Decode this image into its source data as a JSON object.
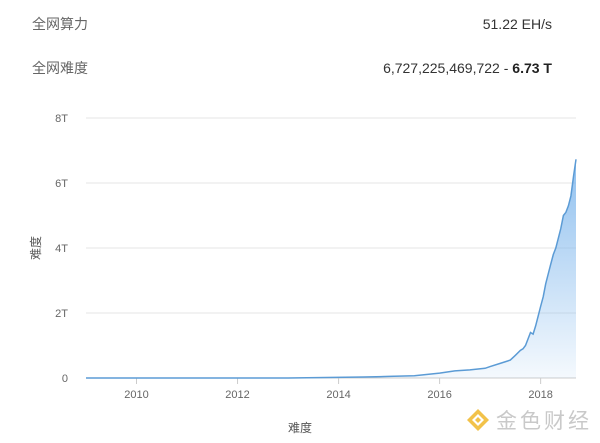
{
  "stats": {
    "hashrate": {
      "label": "全网算力",
      "value": "51.22 EH/s"
    },
    "difficulty": {
      "label": "全网难度",
      "value": "6,727,225,469,722",
      "separator": " - ",
      "short": "6.73 T"
    }
  },
  "watermark": {
    "text": "金色财经",
    "icon": "jinse-logo-icon"
  },
  "chart_data": {
    "type": "area",
    "title": "",
    "xlabel": "难度",
    "ylabel": "难度",
    "x_ticks": [
      "2010",
      "2012",
      "2014",
      "2016",
      "2018"
    ],
    "y_ticks": [
      "0",
      "2T",
      "4T",
      "6T",
      "8T"
    ],
    "xlim": [
      2009.0,
      2018.7
    ],
    "ylim": [
      0,
      8
    ],
    "y_unit": "T",
    "grid": true,
    "legend": "none",
    "color": "#7cb5ec",
    "series": [
      {
        "x": [
          2009.0,
          2011.0,
          2013.0,
          2014.5,
          2015.0,
          2015.5,
          2016.0,
          2016.3,
          2016.6,
          2016.9,
          2017.0,
          2017.2,
          2017.4,
          2017.5,
          2017.6,
          2017.65,
          2017.7,
          2017.75,
          2017.8,
          2017.85,
          2017.9,
          2017.95,
          2018.0,
          2018.05,
          2018.1,
          2018.15,
          2018.2,
          2018.25,
          2018.3,
          2018.35,
          2018.4,
          2018.45,
          2018.5,
          2018.55,
          2018.6,
          2018.65,
          2018.7
        ],
        "values": [
          0,
          0.0001,
          0.0005,
          0.03,
          0.05,
          0.07,
          0.15,
          0.22,
          0.25,
          0.3,
          0.35,
          0.45,
          0.55,
          0.7,
          0.85,
          0.9,
          1.0,
          1.2,
          1.4,
          1.35,
          1.6,
          1.9,
          2.2,
          2.5,
          2.9,
          3.2,
          3.5,
          3.8,
          4.0,
          4.3,
          4.6,
          5.0,
          5.1,
          5.3,
          5.6,
          6.2,
          6.73
        ]
      }
    ]
  }
}
